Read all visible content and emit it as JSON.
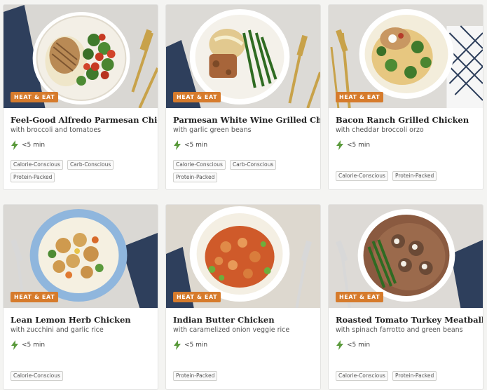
{
  "colors": {
    "badge": "#d67b2c",
    "bolt": "#5a9a3c"
  },
  "icons": {
    "time": "lightning-bolt-icon"
  },
  "cards": [
    {
      "badge": "HEAT & EAT",
      "title": "Feel-Good Alfredo Parmesan Chicken",
      "subtitle": "with broccoli and tomatoes",
      "time": "<5 min",
      "tags": [
        "Calorie-Conscious",
        "Carb-Conscious",
        "Protein-Packed"
      ]
    },
    {
      "badge": "HEAT & EAT",
      "title": "Parmesan White Wine Grilled Chicken",
      "subtitle": "with garlic green beans",
      "time": "<5 min",
      "tags": [
        "Calorie-Conscious",
        "Carb-Conscious",
        "Protein-Packed"
      ]
    },
    {
      "badge": "HEAT & EAT",
      "title": "Bacon Ranch Grilled Chicken",
      "subtitle": "with cheddar broccoli orzo",
      "time": "<5 min",
      "tags": [
        "Calorie-Conscious",
        "Protein-Packed"
      ]
    },
    {
      "badge": "HEAT & EAT",
      "title": "Lean Lemon Herb Chicken",
      "subtitle": "with zucchini and garlic rice",
      "time": "<5 min",
      "tags": [
        "Calorie-Conscious"
      ]
    },
    {
      "badge": "HEAT & EAT",
      "title": "Indian Butter Chicken",
      "subtitle": "with caramelized onion veggie rice",
      "time": "<5 min",
      "tags": [
        "Protein-Packed"
      ]
    },
    {
      "badge": "HEAT & EAT",
      "title": "Roasted Tomato Turkey Meatballs",
      "subtitle": "with spinach farrotto and green beans",
      "time": "<5 min",
      "tags": [
        "Calorie-Conscious",
        "Protein-Packed"
      ]
    }
  ]
}
